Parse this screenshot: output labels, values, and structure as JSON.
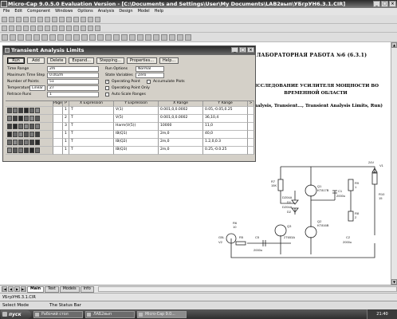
{
  "window": {
    "title": "Micro-Cap 9.0.5.0 Evaluation Version - [C:\\Documents and Settings\\User\\My Documents\\LAB2вып\\УБгрУН6.3.1.CIR]",
    "controls": [
      "_",
      "□",
      "×"
    ]
  },
  "menu": [
    "File",
    "Edit",
    "Component",
    "Windows",
    "Options",
    "Analysis",
    "Design",
    "Model",
    "Help"
  ],
  "dialog": {
    "title": "Transient Analysis Limits",
    "buttons": [
      "Run",
      "Add",
      "Delete",
      "Expand...",
      "Stepping...",
      "Properties...",
      "Help..."
    ],
    "fields": [
      {
        "label": "Time Range",
        "value": "2m"
      },
      {
        "label": "Maximum Time Step",
        "value": "0.002m"
      },
      {
        "label": "Number of Points",
        "value": "51"
      },
      {
        "label": "Temperature",
        "mode": "Linear",
        "value": "27"
      },
      {
        "label": "Retrace Runs",
        "value": "1"
      }
    ],
    "run_options": {
      "label": "Run Options",
      "value": "Normal"
    },
    "state_variables": {
      "label": "State Variables",
      "value": "Zero"
    },
    "checks": [
      {
        "label": "Operating Point",
        "checked": true
      },
      {
        "label": "Operating Point Only",
        "checked": false
      },
      {
        "label": "Auto Scale Ranges",
        "checked": false
      },
      {
        "label": "Accumulate Plots",
        "checked": false
      }
    ],
    "table": {
      "headers": [
        "Page",
        "P",
        "X Expression",
        "Y Expression",
        "X Range",
        "Y Range",
        ">"
      ],
      "rows": [
        {
          "page": "",
          "p": "1",
          "x": "T",
          "y": "V(1)",
          "xr": "0.001,0,0.0002",
          "yr": "0.05,-0.05,0.25"
        },
        {
          "page": "",
          "p": "2",
          "x": "T",
          "y": "V(5)",
          "xr": "0.001,0,0.0002",
          "yr": "36,10,4"
        },
        {
          "page": "",
          "p": "3",
          "x": "T",
          "y": "Harm(V(5))",
          "xr": "10000",
          "yr": "11,0"
        },
        {
          "page": "",
          "p": "1",
          "x": "T",
          "y": "IB(Q1)",
          "xr": "2m,0",
          "yr": "40,0"
        },
        {
          "page": "",
          "p": "1",
          "x": "T",
          "y": "IB(Q2)",
          "xr": "2m,0",
          "yr": "1.2,0,0.3"
        },
        {
          "page": "",
          "p": "1",
          "x": "T",
          "y": "IB(Q3)",
          "xr": "2m,0",
          "yr": "0.25,-0.0.25"
        }
      ],
      "swatch_colors": [
        "#5a5a5a",
        "#7a7a7a",
        "#404040",
        "#2a2a2a",
        "#6a6a6a",
        "#8a8a8a"
      ]
    }
  },
  "document": {
    "title": "ЛАБОРАТОРНАЯ РАБОТА №6 (6.3.1)",
    "subtitle": "ИССЛЕДОВАНИЕ УСИЛИТЕЛЯ МОЩНОСТИ ВО ВРЕМЕННОЙ ОБЛАСТИ",
    "note": "(Analysis, Transient..., Transient Analysis Limits, Run)"
  },
  "schematic": {
    "labels": [
      "R7",
      "15K",
      "Q1",
      "KT817B",
      "D204A",
      "D1",
      "D204A",
      "D2",
      "Q3",
      "2T653A",
      "C1",
      "2000u",
      "R9",
      "1",
      "R8",
      "2",
      "Q2",
      "KT816B",
      "R10",
      "15",
      "24V",
      "V1",
      "R6",
      "10",
      "C5",
      "2000u",
      "G5L",
      "V2",
      "R5",
      "C2",
      "2000u"
    ]
  },
  "tabs": [
    "Main",
    "Text",
    "Models",
    "Info"
  ],
  "path_bar": "УБгрУН6.3.1.CIR",
  "status": {
    "left": "Select Mode",
    "right": "The Status Bar"
  },
  "taskbar": {
    "start": "пуск",
    "tasks": [
      "Рабочий стол",
      "ЛАБ2вып",
      "Micro-Cap 9.0..."
    ],
    "clock": "21:40"
  }
}
